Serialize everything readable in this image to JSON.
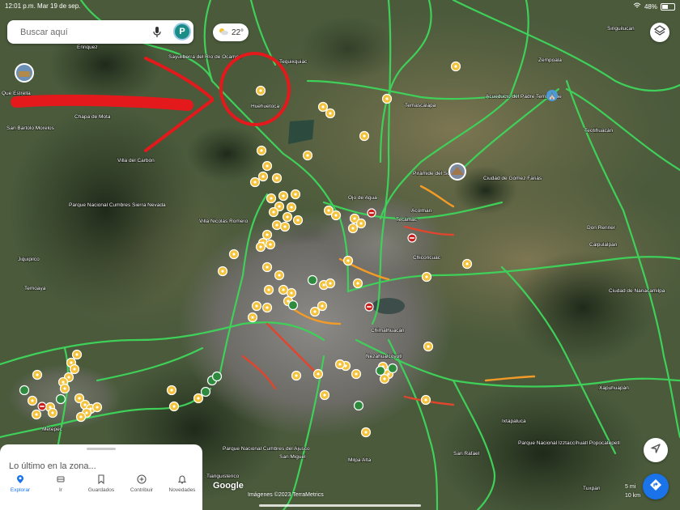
{
  "status_bar": {
    "time": "12:01 p.m.  Mar 19 de sep.",
    "battery": "48%",
    "battery_level": 0.48
  },
  "search": {
    "placeholder": "Buscar aquí",
    "avatar_letter": "P"
  },
  "weather": {
    "temp": "22°"
  },
  "place_labels": [
    "Que Estrella",
    "Enriquez",
    "Chapa de Mota",
    "San Bartolo Morelos",
    "Villa del Carbón",
    "Parque Nacional Cumbres Sierra Nevada",
    "Jiquipilco",
    "Temoaya",
    "Metepec",
    "Sayuliberra del Río de Ocampo",
    "Tequixquiac",
    "Huehuetoca",
    "Temascalapa",
    "Pirámide del Sol",
    "Acueducto del Padre Tembleque",
    "Singuilucan",
    "Zempoala",
    "Ciudad de Gómez Fariás",
    "Teotihuacán",
    "Ojo de Agua",
    "Tecámac",
    "Acolman",
    "Chiconcuac",
    "Don Renner",
    "Calpulalpan",
    "Villa Nicolas Romero",
    "Nezahualcóyotl",
    "Chimalhuacán",
    "Ciudad de Nanacamilpa",
    "Ixtapaluca",
    "Parque Nacional Izztaccíhuatl Popocatépetl",
    "Parque Nacional Cumbres del Ajusco",
    "San Miguel",
    "Milpa Alta",
    "San Rafael",
    "Tianguistenco",
    "Tuxpan",
    "Xapuhuapán"
  ],
  "bottom_sheet": {
    "title": "Lo último en la zona..."
  },
  "nav": [
    {
      "label": "Explorar",
      "icon": "pin-icon",
      "active": true
    },
    {
      "label": "Ir",
      "icon": "car-icon",
      "active": false
    },
    {
      "label": "Guardados",
      "icon": "bookmark-icon",
      "active": false
    },
    {
      "label": "Contribuir",
      "icon": "plus-circle-icon",
      "active": false
    },
    {
      "label": "Novedades",
      "icon": "bell-icon",
      "active": false
    }
  ],
  "map_logo": "Google",
  "attribution": "Imágenes ©2023 TerraMetrics",
  "scale": {
    "top": "5 mi",
    "bottom": "10 km"
  },
  "colors": {
    "accent": "#1a73e8",
    "traffic_green": "#3fd05a",
    "traffic_red": "#e0452e",
    "traffic_orange": "#f29b27",
    "pin_yellow": "#f4c33e",
    "annotation_red": "#e3191c"
  }
}
